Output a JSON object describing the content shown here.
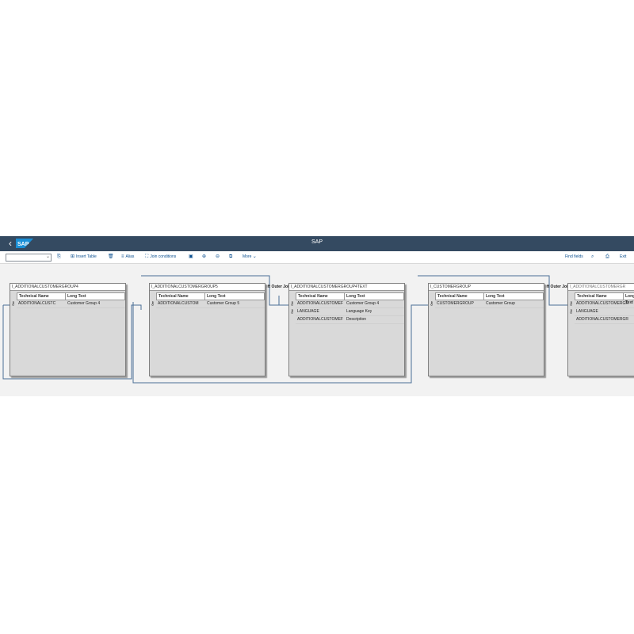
{
  "shell": {
    "back": "‹",
    "logo": "SAP",
    "title": "SAP"
  },
  "toolbar": {
    "zoom_value": "",
    "insert_table": "Insert Table",
    "alias": "Alias",
    "join_conditions": "Join conditions",
    "more": "More",
    "find_fields": "Find fields",
    "exit": "Exit"
  },
  "tables": [
    {
      "name": "I_ADDITIONALCUSTOMERGROUP4",
      "rows": [
        {
          "tech": "ADDITIONALCUSTC",
          "long": "Customer Group 4",
          "key": true
        }
      ]
    },
    {
      "name": "I_ADDITIONALCUSTOMERGROUP5",
      "rows": [
        {
          "tech": "ADDITIONALCUSTOM",
          "long": "Customer Group 5",
          "key": true
        }
      ]
    },
    {
      "name": "I_ADDITIONALCUSTOMERGROUP4TEXT",
      "rows": [
        {
          "tech": "ADDITIONALCUSTOMEF",
          "long": "Customer Group 4",
          "key": true
        },
        {
          "tech": "LANGUAGE",
          "long": "Language Key",
          "key": true
        },
        {
          "tech": "ADDITIONALCUSTOMEF",
          "long": "Description",
          "key": false
        }
      ]
    },
    {
      "name": "I_CUSTOMERGROUP",
      "rows": [
        {
          "tech": "CUSTOMERGROUP",
          "long": "Customer Group",
          "key": true
        }
      ]
    },
    {
      "name": "I_ADDITIONALCUSTOMERGR",
      "rows": [
        {
          "tech": "ADDITIONALCUSTOMERGR",
          "long": "",
          "key": true
        },
        {
          "tech": "LANGUAGE",
          "long": "",
          "key": true
        },
        {
          "tech": "ADDITIONALCUSTOMERGR",
          "long": "",
          "key": false
        }
      ]
    }
  ],
  "columns": {
    "tech": "Technical Name",
    "long": "Long Text"
  },
  "joins": [
    "Left Outer Join",
    "Left Outer Join"
  ],
  "colors": {
    "shell": "#344a61",
    "line": "#4a6f96"
  }
}
